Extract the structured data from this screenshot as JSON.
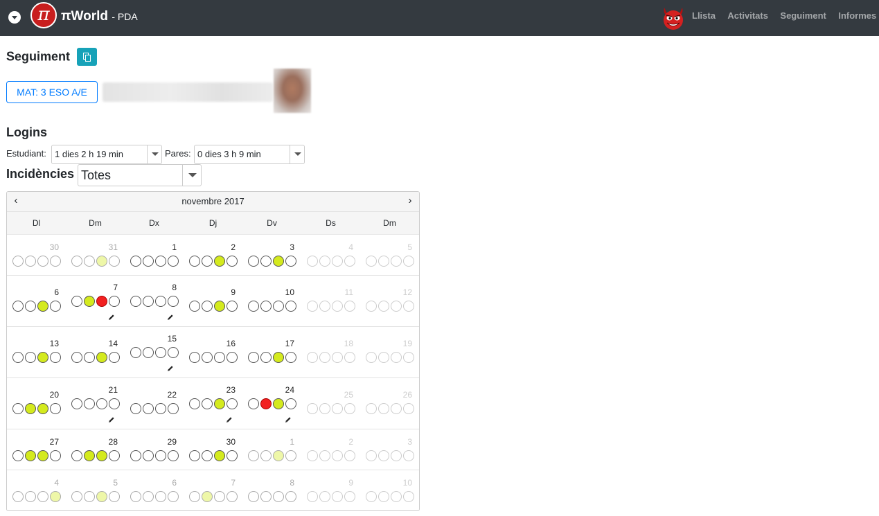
{
  "navbar": {
    "logo_glyph": "π",
    "brand": "πWorld",
    "brand_sub": "- PDA",
    "links": [
      "Llista",
      "Activitats",
      "Seguiment",
      "Informes"
    ],
    "colors": {
      "bg": "#343a40",
      "link": "#9a9da1"
    }
  },
  "page": {
    "title": "Seguiment",
    "group_button": "MAT: 3 ESO A/E"
  },
  "logins": {
    "title": "Logins",
    "student_label": "Estudiant:",
    "student_value": "1 dies 2 h 19 min",
    "parents_label": "Pares:",
    "parents_value": "0 dies 3 h 9 min"
  },
  "incidencies": {
    "label": "Incidències",
    "value": "Totes"
  },
  "calendar": {
    "month": "novembre 2017",
    "prev": "‹",
    "next": "›",
    "weekdays": [
      "Dl",
      "Dm",
      "Dx",
      "Dj",
      "Dv",
      "Ds",
      "Dm"
    ],
    "colors": {
      "green": "#d4ea1e",
      "red": "#f22020"
    },
    "weeks": [
      {
        "tall": false,
        "days": [
          {
            "n": "30",
            "s": "muted",
            "c": "0000"
          },
          {
            "n": "31",
            "s": "muted",
            "c": "00g0"
          },
          {
            "n": "1",
            "s": "",
            "c": "0000"
          },
          {
            "n": "2",
            "s": "",
            "c": "00g0"
          },
          {
            "n": "3",
            "s": "",
            "c": "00g0"
          },
          {
            "n": "4",
            "s": "far",
            "c": "0000"
          },
          {
            "n": "5",
            "s": "far",
            "c": "0000"
          }
        ]
      },
      {
        "tall": true,
        "days": [
          {
            "n": "6",
            "s": "",
            "c": "00g0"
          },
          {
            "n": "7",
            "s": "",
            "c": "0gr0",
            "edit": true
          },
          {
            "n": "8",
            "s": "",
            "c": "0000",
            "edit": true
          },
          {
            "n": "9",
            "s": "",
            "c": "00g0"
          },
          {
            "n": "10",
            "s": "",
            "c": "0000"
          },
          {
            "n": "11",
            "s": "far",
            "c": "0000"
          },
          {
            "n": "12",
            "s": "far",
            "c": "0000"
          }
        ]
      },
      {
        "tall": true,
        "days": [
          {
            "n": "13",
            "s": "",
            "c": "00g0"
          },
          {
            "n": "14",
            "s": "",
            "c": "00g0"
          },
          {
            "n": "15",
            "s": "",
            "c": "0000",
            "edit": true
          },
          {
            "n": "16",
            "s": "",
            "c": "0000"
          },
          {
            "n": "17",
            "s": "",
            "c": "00g0"
          },
          {
            "n": "18",
            "s": "far",
            "c": "0000"
          },
          {
            "n": "19",
            "s": "far",
            "c": "0000"
          }
        ]
      },
      {
        "tall": true,
        "days": [
          {
            "n": "20",
            "s": "",
            "c": "0gg0"
          },
          {
            "n": "21",
            "s": "",
            "c": "0000",
            "edit": true
          },
          {
            "n": "22",
            "s": "",
            "c": "0000"
          },
          {
            "n": "23",
            "s": "",
            "c": "00g0",
            "edit": true
          },
          {
            "n": "24",
            "s": "",
            "c": "0rg0",
            "edit": true
          },
          {
            "n": "25",
            "s": "far",
            "c": "0000"
          },
          {
            "n": "26",
            "s": "far",
            "c": "0000"
          }
        ]
      },
      {
        "tall": false,
        "days": [
          {
            "n": "27",
            "s": "",
            "c": "0gg0"
          },
          {
            "n": "28",
            "s": "",
            "c": "0gg0"
          },
          {
            "n": "29",
            "s": "",
            "c": "0000"
          },
          {
            "n": "30",
            "s": "",
            "c": "00g0"
          },
          {
            "n": "1",
            "s": "muted",
            "c": "00g0"
          },
          {
            "n": "2",
            "s": "far",
            "c": "0000"
          },
          {
            "n": "3",
            "s": "far",
            "c": "0000"
          }
        ]
      },
      {
        "tall": false,
        "days": [
          {
            "n": "4",
            "s": "muted",
            "c": "000g"
          },
          {
            "n": "5",
            "s": "muted",
            "c": "00g0"
          },
          {
            "n": "6",
            "s": "muted",
            "c": "0000"
          },
          {
            "n": "7",
            "s": "muted",
            "c": "0g00"
          },
          {
            "n": "8",
            "s": "muted",
            "c": "0000"
          },
          {
            "n": "9",
            "s": "far",
            "c": "0000"
          },
          {
            "n": "10",
            "s": "far",
            "c": "0000"
          }
        ]
      }
    ]
  }
}
